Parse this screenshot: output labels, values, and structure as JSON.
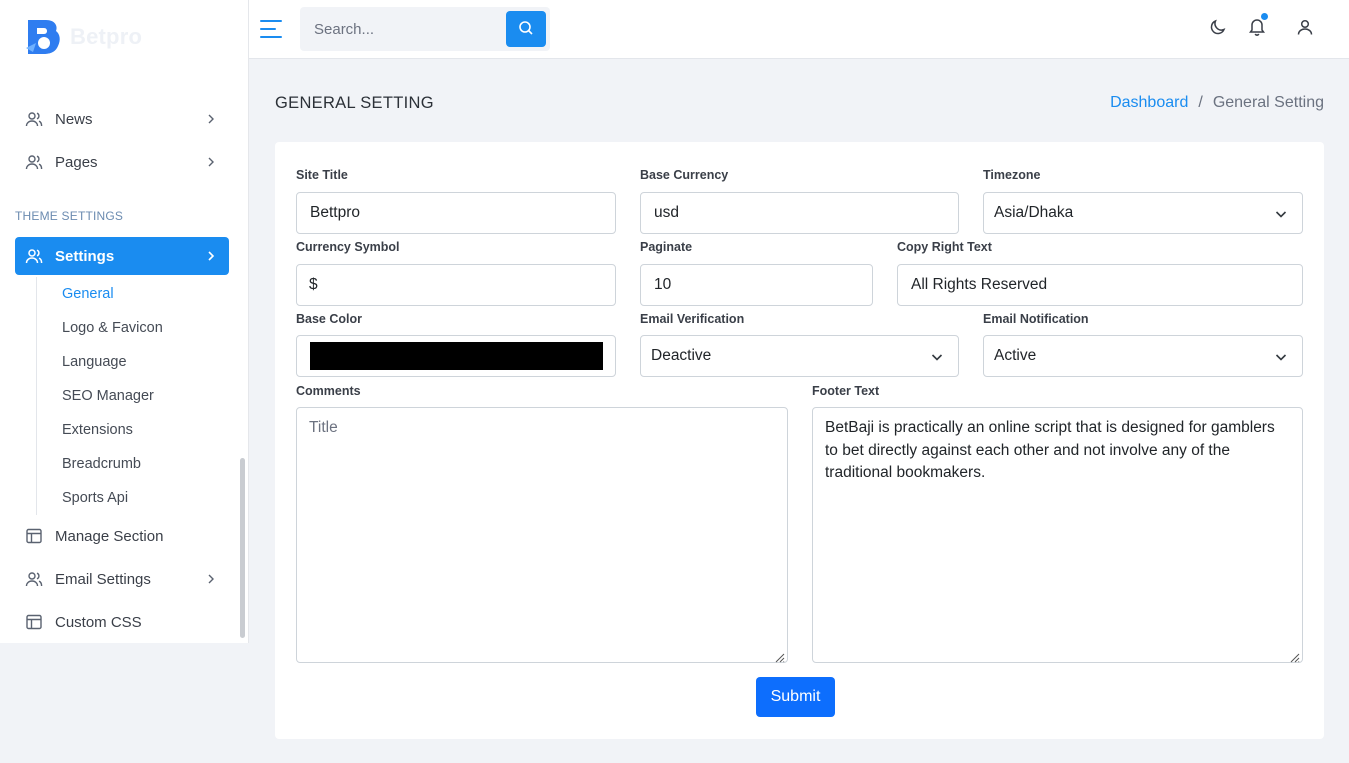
{
  "brand": {
    "name": "Betpro",
    "accent": "#1a8cf0"
  },
  "sidebar": {
    "items_top": [
      {
        "label": "News",
        "icon": "users-icon"
      },
      {
        "label": "Pages",
        "icon": "users-icon"
      }
    ],
    "section_title": "THEME SETTINGS",
    "active_item": {
      "label": "Settings",
      "icon": "users-icon"
    },
    "sub_items": [
      {
        "label": "General",
        "active": true
      },
      {
        "label": "Logo & Favicon"
      },
      {
        "label": "Language"
      },
      {
        "label": "SEO Manager"
      },
      {
        "label": "Extensions"
      },
      {
        "label": "Breadcrumb"
      },
      {
        "label": "Sports Api"
      }
    ],
    "items_bottom": [
      {
        "label": "Manage Section",
        "icon": "table-icon"
      },
      {
        "label": "Email Settings",
        "icon": "users-icon"
      },
      {
        "label": "Custom CSS",
        "icon": "table-icon"
      }
    ]
  },
  "header": {
    "search_placeholder": "Search..."
  },
  "page": {
    "title": "GENERAL SETTING",
    "breadcrumb": {
      "home": "Dashboard",
      "separator": "/",
      "current": "General Setting"
    }
  },
  "form": {
    "site_title": {
      "label": "Site Title",
      "value": "Bettpro"
    },
    "base_currency": {
      "label": "Base Currency",
      "value": "usd"
    },
    "timezone": {
      "label": "Timezone",
      "value": "Asia/Dhaka"
    },
    "currency_symbol": {
      "label": "Currency Symbol",
      "value": "$"
    },
    "paginate": {
      "label": "Paginate",
      "value": "10"
    },
    "copyright": {
      "label": "Copy Right Text",
      "value": "All Rights Reserved"
    },
    "base_color": {
      "label": "Base Color",
      "value": "#000000"
    },
    "email_verification": {
      "label": "Email Verification",
      "value": "Deactive"
    },
    "email_notification": {
      "label": "Email Notification",
      "value": "Active"
    },
    "comments": {
      "label": "Comments",
      "placeholder": "Title"
    },
    "footer_text": {
      "label": "Footer Text",
      "value": "BetBaji is practically an online script that is designed for gamblers to bet directly against each other and not involve any of the traditional bookmakers."
    },
    "submit_label": "Submit"
  }
}
